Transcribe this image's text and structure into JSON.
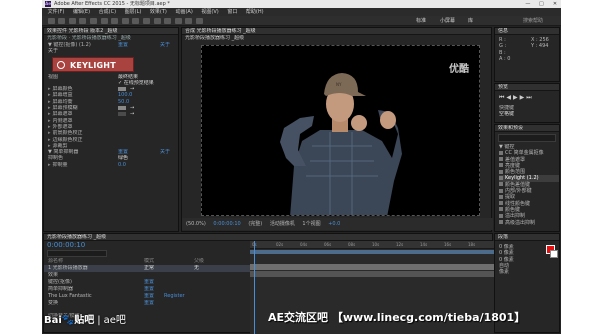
{
  "window": {
    "title": "Adobe After Effects CC 2015 - 无标题项目.aep *",
    "controls": [
      "—",
      "□",
      "✕"
    ]
  },
  "menu": [
    "文件(F)",
    "编辑(E)",
    "合成(C)",
    "图层(L)",
    "效果(T)",
    "动画(A)",
    "视图(V)",
    "窗口",
    "帮助(H)"
  ],
  "toolbar": {
    "workspaces": [
      "标准",
      "小屏幕",
      "库"
    ],
    "search_placeholder": "搜索帮助"
  },
  "effect_controls": {
    "tab": "效果控件 光影桥段 版本2 _超级",
    "subtitle": "光影桥段 · 光影桥段播放器练习 _超级",
    "plugin_name": "KEYLIGHT",
    "rows": [
      {
        "label": "▼ 键控(抠像) (1.2)",
        "value": "重置",
        "extra": "关于"
      },
      {
        "label": "关于",
        "value": ""
      },
      {
        "label": "视图",
        "value": "最终结果"
      },
      {
        "label": "",
        "value": "✓ 在线预览结果"
      },
      {
        "label": "屏幕颜色",
        "value": ""
      },
      {
        "label": "屏幕增益",
        "value": "100.0"
      },
      {
        "label": "屏幕均衡",
        "value": "50.0"
      },
      {
        "label": "屏幕预模糊",
        "value": "0.0"
      },
      {
        "label": "屏幕遮罩",
        "value": ""
      },
      {
        "label": "内侧遮罩",
        "value": ""
      },
      {
        "label": "外部遮罩",
        "value": ""
      },
      {
        "label": "前景颜色校正",
        "value": ""
      },
      {
        "label": "边缘颜色校正",
        "value": ""
      },
      {
        "label": "源裁剪",
        "value": ""
      },
      {
        "label": "▼ 简单抑制器",
        "value": "重置",
        "extra": "关于"
      },
      {
        "label": "抑制色",
        "value": "绿色"
      },
      {
        "label": "抑制量",
        "value": "0.0"
      }
    ]
  },
  "viewer": {
    "tab": "合成 光影桥段播放器练习 _超级",
    "sub": "光影桥段播放器练习 _超级",
    "watermark": "优酷",
    "controls": [
      "(50.0%)",
      "0:00:00:10",
      "(完整)",
      "活动摄像机",
      "1个视图",
      "+0.0"
    ]
  },
  "info": {
    "tab": "信息",
    "values": [
      "R :",
      "G :",
      "B :",
      "A : 0",
      "X : 256",
      "Y : 494"
    ]
  },
  "preview": {
    "tab": "预览",
    "label": "快捷键",
    "value": "空格键"
  },
  "effects_presets": {
    "tab": "效果和预设",
    "items": [
      "▼ 键控",
      "CC 简单金属抠像",
      "差值遮罩",
      "亮度键",
      "颜色范围",
      "Keylight (1.2)",
      "颜色差值键",
      "内部/外部键",
      "提取",
      "线性颜色键",
      "颜色键",
      "溢出抑制",
      "高级溢出抑制"
    ],
    "selected_index": 5
  },
  "paragraph": {
    "tab": "段落",
    "rows": [
      "0 像素",
      "0 像素",
      "0 像素",
      "自动",
      "像素"
    ]
  },
  "timeline": {
    "tab": "光影桥段播放器练习 _超级",
    "timecode": "0:00:00:10",
    "rows": [
      {
        "label": "源名称",
        "v1": "模式",
        "v2": "父级"
      },
      {
        "label": "1  光影桥段播放器",
        "v1": "正常",
        "v2": "无"
      },
      {
        "label": "  效果",
        "v1": "",
        "v2": ""
      },
      {
        "label": "    键控(抠像)",
        "v1": "重置",
        "v2": ""
      },
      {
        "label": "    简单抑制器",
        "v1": "重置",
        "v2": ""
      },
      {
        "label": "    The Lux Fantastic",
        "v1": "重置",
        "v2": "Register"
      },
      {
        "label": "  变换",
        "v1": "重置",
        "v2": ""
      }
    ],
    "ticks": [
      "0s",
      "02s",
      "04s",
      "06s",
      "08s",
      "10s",
      "12s",
      "14s",
      "16s",
      "18s"
    ],
    "footer": "切换开关/模式"
  },
  "overlays": {
    "baidu": "Bai",
    "baidu2": "贴吧",
    "baidu3": "ae吧",
    "site": "AE交流区吧 【www.linecg.com/tieba/1801】"
  }
}
